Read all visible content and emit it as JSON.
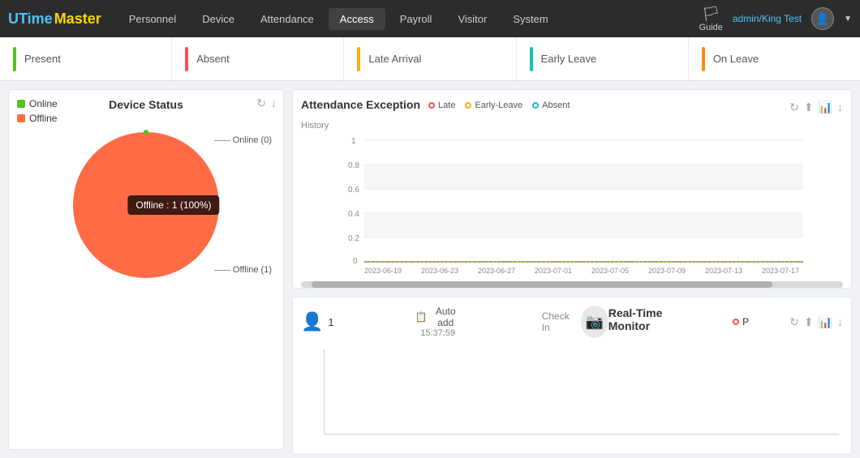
{
  "brand": {
    "u": "U",
    "time": "Time",
    "master": "Master"
  },
  "nav": {
    "links": [
      {
        "label": "Personnel",
        "active": false
      },
      {
        "label": "Device",
        "active": false
      },
      {
        "label": "Attendance",
        "active": false
      },
      {
        "label": "Access",
        "active": true
      },
      {
        "label": "Payroll",
        "active": false
      },
      {
        "label": "Visitor",
        "active": false
      },
      {
        "label": "System",
        "active": false
      }
    ],
    "guide_label": "Guide",
    "user": "admin/King Test"
  },
  "summary": {
    "cards": [
      {
        "label": "Present",
        "color_class": "present-bar"
      },
      {
        "label": "Absent",
        "color_class": "absent-bar"
      },
      {
        "label": "Late Arrival",
        "color_class": "late-bar"
      },
      {
        "label": "Early Leave",
        "color_class": "early-bar"
      },
      {
        "label": "On Leave",
        "color_class": "onleave-bar"
      }
    ]
  },
  "device_status": {
    "title": "Device Status",
    "legend_online": "Online",
    "legend_offline": "Offline",
    "pie_label_online": "Online (0)",
    "pie_label_offline": "Offline (1)",
    "tooltip": "Offline : 1 (100%)",
    "refresh_icon": "↻",
    "download_icon": "↓"
  },
  "attendance_exception": {
    "title": "Attendance Exception",
    "history_label": "History",
    "legend": [
      {
        "label": "Late",
        "color": "#ff4d4f"
      },
      {
        "label": "Early-Leave",
        "color": "#faad14"
      },
      {
        "label": "Absent",
        "color": "#13c2c2"
      }
    ],
    "y_labels": [
      "1",
      "0.8",
      "0.6",
      "0.4",
      "0.2",
      "0"
    ],
    "x_labels": [
      "2023-06-19",
      "2023-06-23",
      "2023-06-27",
      "2023-07-01",
      "2023-07-05",
      "2023-07-09",
      "2023-07-13",
      "2023-07-17"
    ]
  },
  "realtime_monitor": {
    "title": "Real-Time Monitor",
    "person_count": "1",
    "auto_add_label": "Auto add",
    "auto_add_time": "15:37:59",
    "checkin_label": "Check In",
    "p_legend": "P",
    "p_color": "#ff4d4f"
  }
}
